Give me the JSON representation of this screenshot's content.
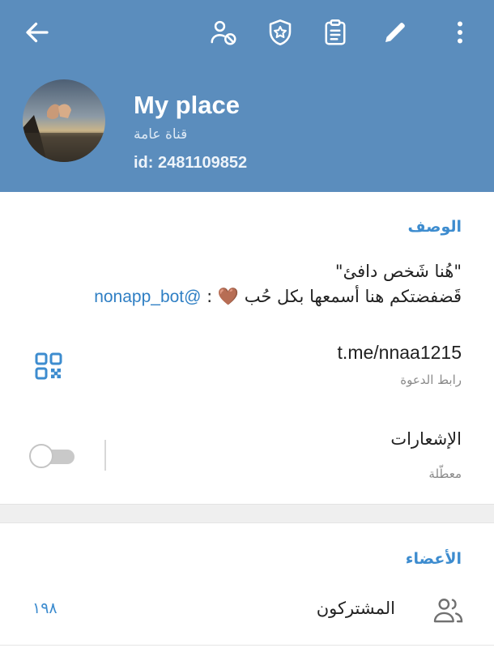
{
  "toolbar": {
    "back_icon": "arrow-left-icon",
    "icons": [
      "user-block-icon",
      "shield-star-icon",
      "clipboard-icon",
      "pencil-icon",
      "more-vertical-icon"
    ]
  },
  "channel": {
    "name": "My place",
    "type": "قناة عامة",
    "id_line": "id: 2481109852"
  },
  "info": {
    "description_title": "الوصف",
    "description_line1": "\"هُنا شَخص دافئ\"",
    "description_line2_text": "قَضفضتكم هنا أسمعها بكل حُب",
    "description_emoji": "🤎",
    "description_separator": ":",
    "description_handle": "@nonapp_bot",
    "invite_link": "t.me/nnaa1215",
    "invite_link_caption": "رابط الدعوة",
    "notifications_label": "الإشعارات",
    "notifications_state": "معطّلة"
  },
  "members": {
    "title": "الأعضاء",
    "subscribers_label": "المشتركون",
    "subscribers_count": "١٩٨"
  },
  "colors": {
    "header_bg": "#5b8dbd",
    "accent": "#3d8ccf"
  }
}
